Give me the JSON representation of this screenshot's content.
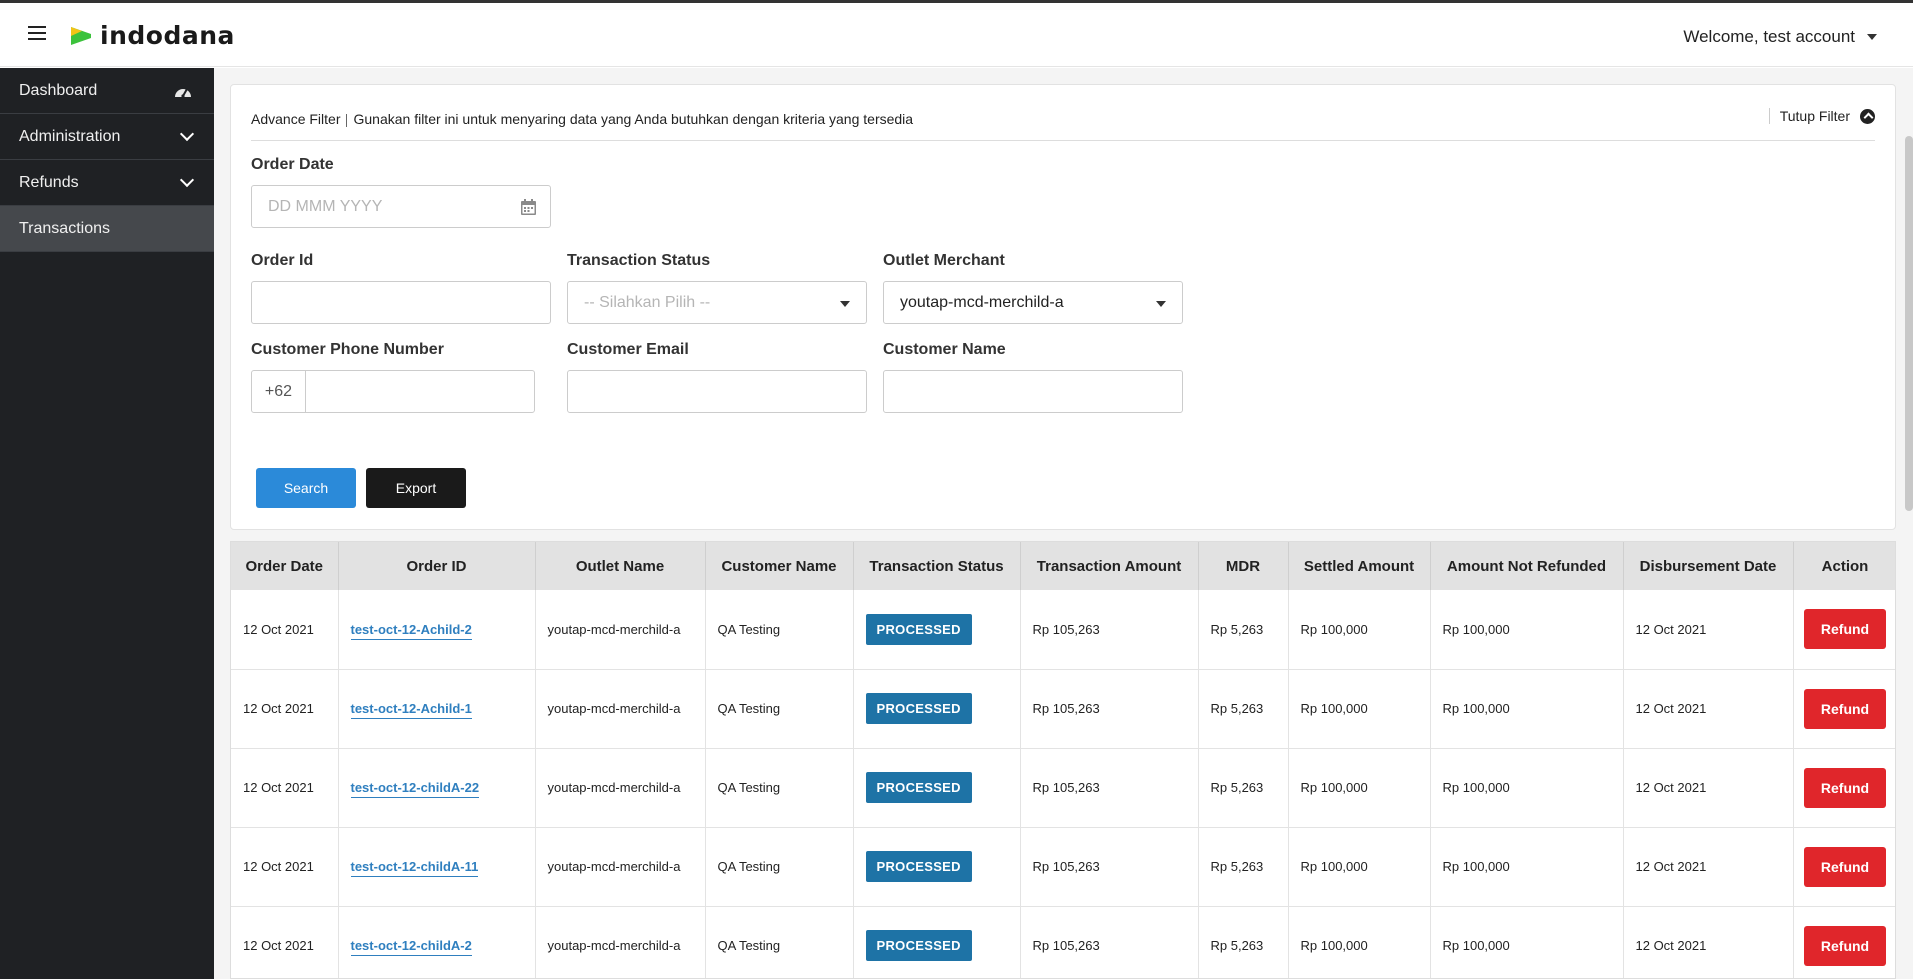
{
  "header": {
    "brand": "indodana",
    "welcome": "Welcome, test account"
  },
  "sidebar": {
    "items": [
      {
        "label": "Dashboard",
        "icon": "dashboard-gauge-icon"
      },
      {
        "label": "Administration",
        "icon": "chevron-down-icon"
      },
      {
        "label": "Refunds",
        "icon": "chevron-down-icon"
      },
      {
        "label": "Transactions",
        "active": true
      }
    ]
  },
  "filter": {
    "title": "Advance Filter",
    "description": "Gunakan filter ini untuk menyaring data yang Anda butuhkan dengan kriteria yang tersedia",
    "close_label": "Tutup Filter",
    "order_date_label": "Order Date",
    "order_date_placeholder": "DD MMM YYYY",
    "order_id_label": "Order Id",
    "order_id_value": "",
    "transaction_status_label": "Transaction Status",
    "transaction_status_placeholder": "-- Silahkan Pilih --",
    "outlet_merchant_label": "Outlet Merchant",
    "outlet_merchant_value": "youtap-mcd-merchild-a",
    "customer_phone_label": "Customer Phone Number",
    "phone_prefix": "+62",
    "customer_phone_value": "",
    "customer_email_label": "Customer Email",
    "customer_email_value": "",
    "customer_name_label": "Customer Name",
    "customer_name_value": "",
    "search_label": "Search",
    "export_label": "Export"
  },
  "table": {
    "headers": [
      "Order Date",
      "Order ID",
      "Outlet Name",
      "Customer Name",
      "Transaction Status",
      "Transaction Amount",
      "MDR",
      "Settled Amount",
      "Amount Not Refunded",
      "Disbursement Date",
      "Action"
    ],
    "rows": [
      {
        "order_date": "12 Oct 2021",
        "order_id": "test-oct-12-Achild-2",
        "outlet": "youtap-mcd-merchild-a",
        "customer": "QA Testing",
        "status": "PROCESSED",
        "amount": "Rp 105,263",
        "mdr": "Rp 5,263",
        "settled": "Rp 100,000",
        "not_refunded": "Rp 100,000",
        "disbursement": "12 Oct 2021",
        "action": "Refund"
      },
      {
        "order_date": "12 Oct 2021",
        "order_id": "test-oct-12-Achild-1",
        "outlet": "youtap-mcd-merchild-a",
        "customer": "QA Testing",
        "status": "PROCESSED",
        "amount": "Rp 105,263",
        "mdr": "Rp 5,263",
        "settled": "Rp 100,000",
        "not_refunded": "Rp 100,000",
        "disbursement": "12 Oct 2021",
        "action": "Refund"
      },
      {
        "order_date": "12 Oct 2021",
        "order_id": "test-oct-12-childA-22",
        "outlet": "youtap-mcd-merchild-a",
        "customer": "QA Testing",
        "status": "PROCESSED",
        "amount": "Rp 105,263",
        "mdr": "Rp 5,263",
        "settled": "Rp 100,000",
        "not_refunded": "Rp 100,000",
        "disbursement": "12 Oct 2021",
        "action": "Refund"
      },
      {
        "order_date": "12 Oct 2021",
        "order_id": "test-oct-12-childA-11",
        "outlet": "youtap-mcd-merchild-a",
        "customer": "QA Testing",
        "status": "PROCESSED",
        "amount": "Rp 105,263",
        "mdr": "Rp 5,263",
        "settled": "Rp 100,000",
        "not_refunded": "Rp 100,000",
        "disbursement": "12 Oct 2021",
        "action": "Refund"
      },
      {
        "order_date": "12 Oct 2021",
        "order_id": "test-oct-12-childA-2",
        "outlet": "youtap-mcd-merchild-a",
        "customer": "QA Testing",
        "status": "PROCESSED",
        "amount": "Rp 105,263",
        "mdr": "Rp 5,263",
        "settled": "Rp 100,000",
        "not_refunded": "Rp 100,000",
        "disbursement": "12 Oct 2021",
        "action": "Refund"
      }
    ]
  },
  "colors": {
    "brand_green": "#3cc23c",
    "brand_yellow": "#f2c417",
    "primary": "#2b8ad9",
    "status": "#1e73a6",
    "danger": "#e0262b",
    "sidebar": "#1f2124"
  }
}
